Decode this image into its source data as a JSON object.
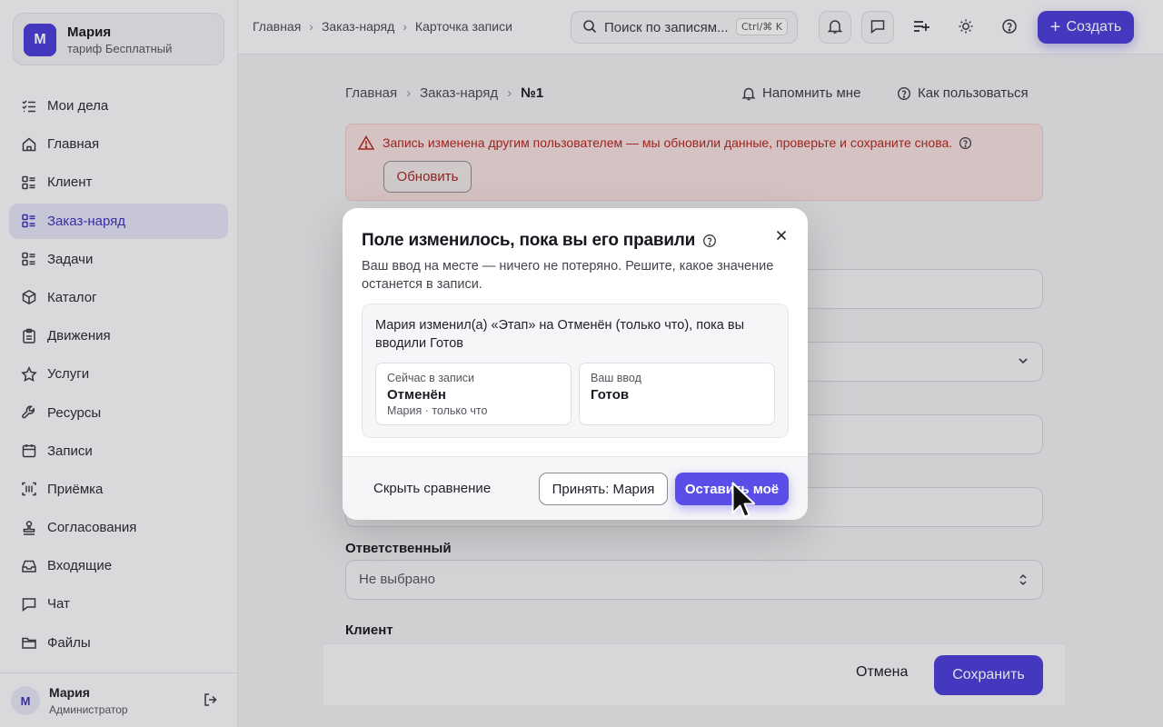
{
  "account": {
    "initial": "М",
    "name": "Мария",
    "plan": "тариф Бесплатный"
  },
  "sidebar": {
    "items": [
      {
        "label": "Мои дела",
        "icon": "checklist-icon"
      },
      {
        "label": "Главная",
        "icon": "home-icon"
      },
      {
        "label": "Клиент",
        "icon": "list-icon"
      },
      {
        "label": "Заказ-наряд",
        "icon": "list-icon",
        "active": true
      },
      {
        "label": "Задачи",
        "icon": "list-icon"
      },
      {
        "label": "Каталог",
        "icon": "box-icon"
      },
      {
        "label": "Движения",
        "icon": "clipboard-icon"
      },
      {
        "label": "Услуги",
        "icon": "star-icon"
      },
      {
        "label": "Ресурсы",
        "icon": "wrench-icon"
      },
      {
        "label": "Записи",
        "icon": "calendar-icon"
      },
      {
        "label": "Приёмка",
        "icon": "barcode-icon"
      },
      {
        "label": "Согласования",
        "icon": "stamp-icon"
      },
      {
        "label": "Входящие",
        "icon": "inbox-icon"
      },
      {
        "label": "Чат",
        "icon": "chat-icon"
      },
      {
        "label": "Файлы",
        "icon": "folder-icon"
      }
    ]
  },
  "user": {
    "initial": "М",
    "name": "Мария",
    "role": "Администратор"
  },
  "topbar": {
    "breadcrumbs": [
      "Главная",
      "Заказ-наряд",
      "Карточка записи"
    ],
    "search_placeholder": "Поиск по записям...",
    "search_shortcut": "Ctrl/⌘ K",
    "create_label": "Создать"
  },
  "main": {
    "breadcrumbs": [
      "Главная",
      "Заказ-наряд",
      "№1"
    ],
    "remind_label": "Напомнить мне",
    "help_label": "Как пользоваться",
    "alert_text": "Запись изменена другим пользователем — мы обновили данные, проверьте и сохраните снова.",
    "refresh_label": "Обновить",
    "responsible_label": "Ответственный",
    "responsible_value": "Не выбрано",
    "client_label": "Клиент",
    "cancel_label": "Отмена",
    "save_label": "Сохранить"
  },
  "modal": {
    "title": "Поле изменилось, пока вы его правили",
    "description": "Ваш ввод на месте — ничего не потеряно. Решите, какое значение останется в записи.",
    "change_text": "Мария изменил(а) «Этап» на Отменён (только что), пока вы вводили Готов",
    "current": {
      "label": "Сейчас в записи",
      "value": "Отменён",
      "meta": "Мария · только что"
    },
    "yours": {
      "label": "Ваш ввод",
      "value": "Готов"
    },
    "hide_label": "Скрыть сравнение",
    "accept_label": "Принять: Мария",
    "keep_label": "Оставить моё"
  },
  "colors": {
    "accent": "#4b3fd6",
    "danger": "#b3261e",
    "alert_bg": "#f2dcdc"
  }
}
